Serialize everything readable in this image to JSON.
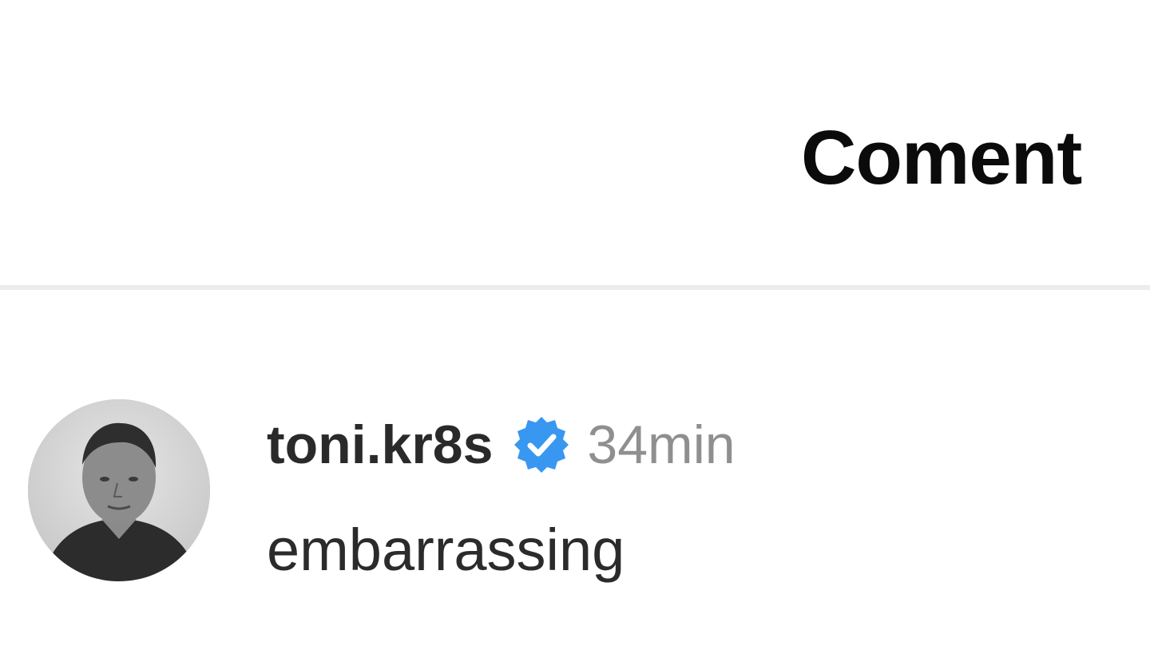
{
  "header": {
    "title": "Coment"
  },
  "comment": {
    "username": "toni.kr8s",
    "time": "34min",
    "text": "embarrassing",
    "verified_icon": "verified-badge-icon",
    "verified_color": "#3897f0"
  },
  "colors": {
    "background": "#ffffff",
    "divider": "#ececec",
    "title": "#0b0b0b",
    "username": "#2a2a2a",
    "time": "#8f8f8f"
  }
}
